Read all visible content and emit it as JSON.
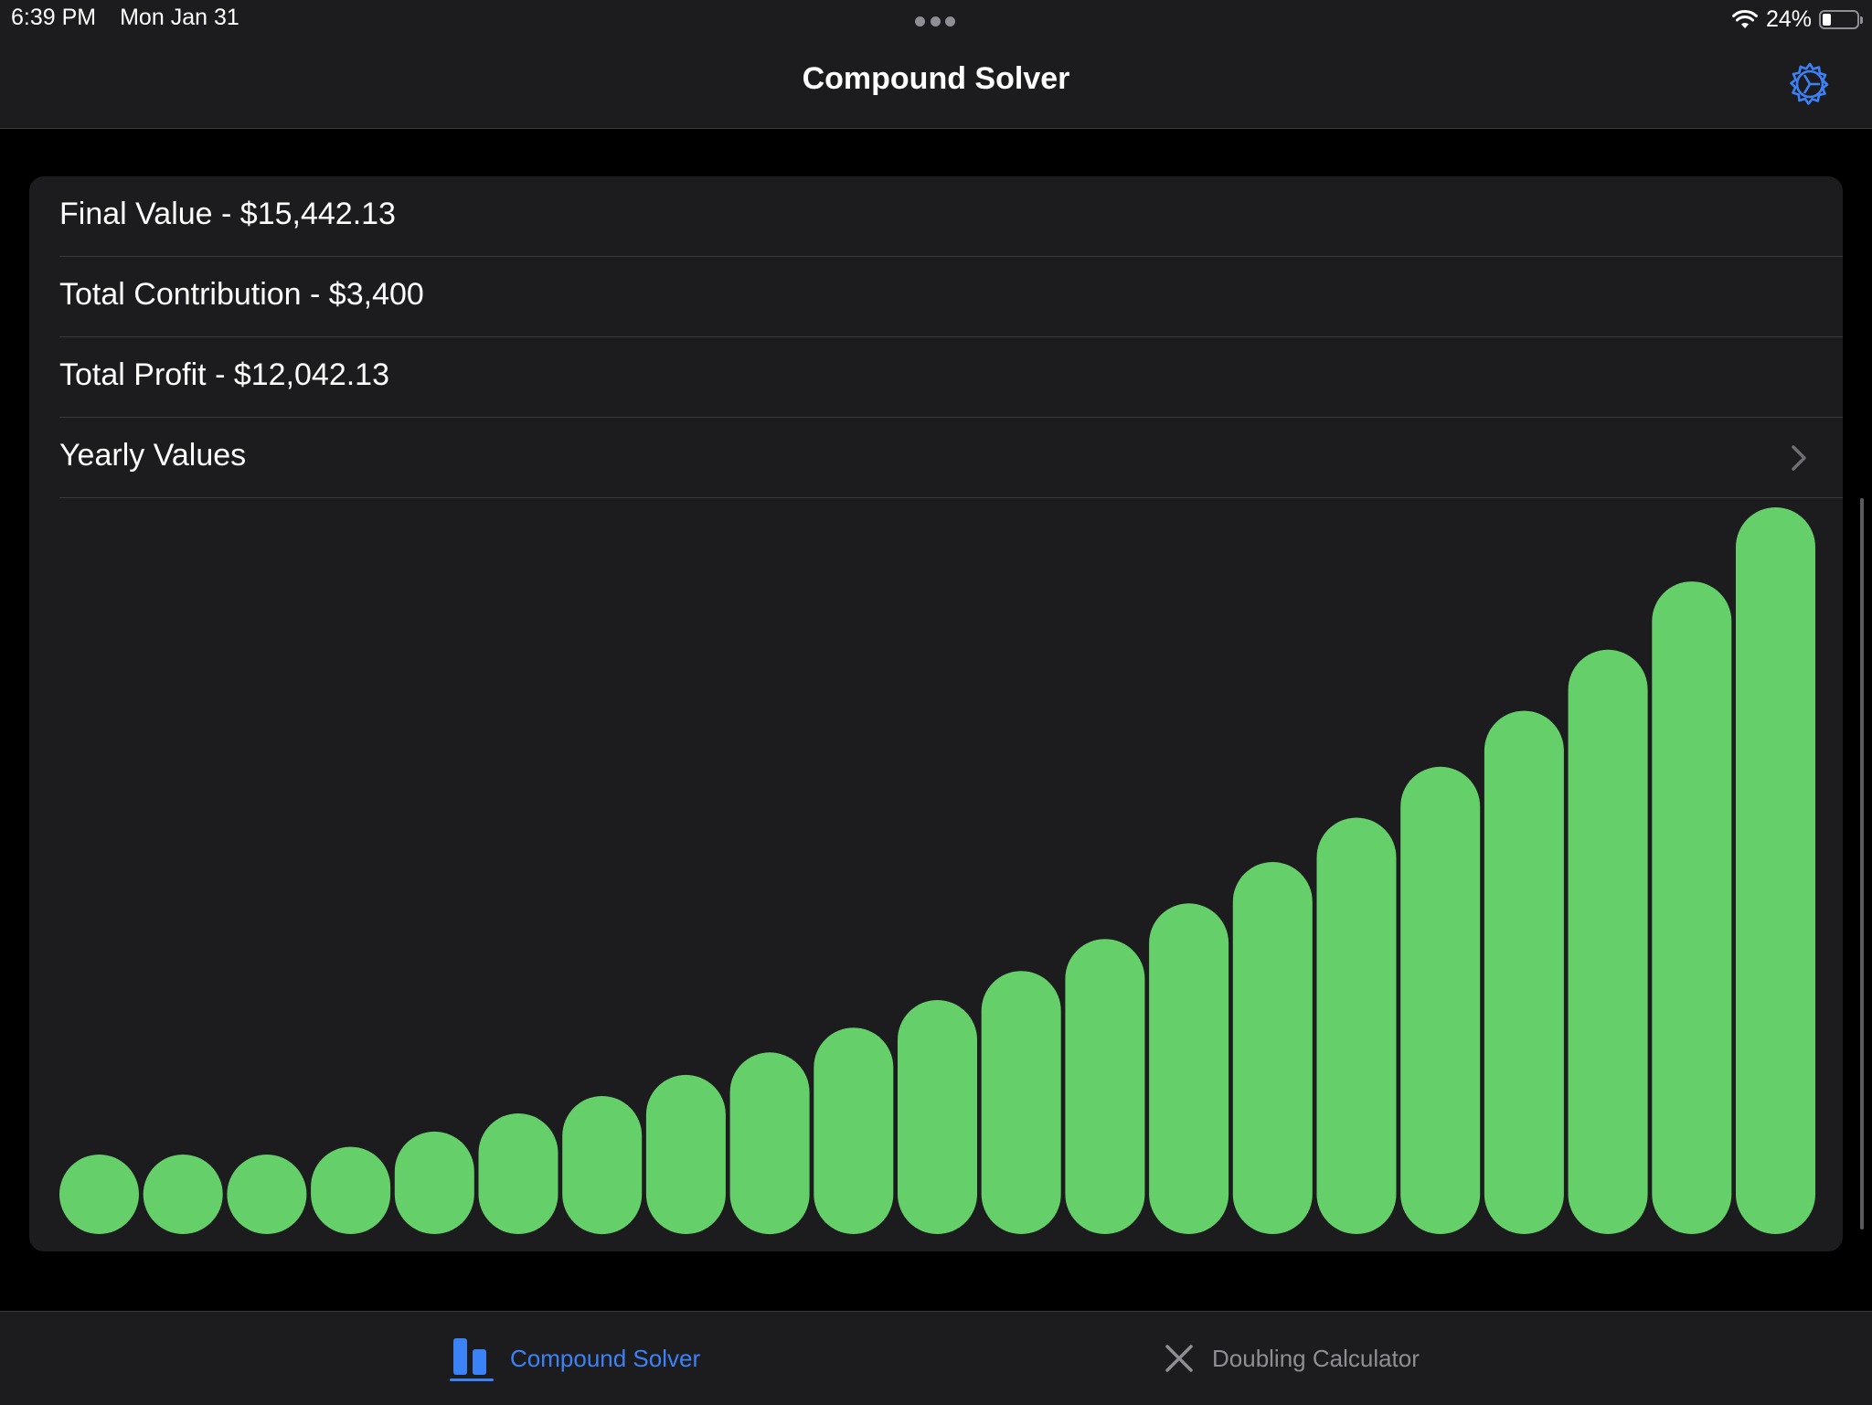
{
  "status_bar": {
    "time": "6:39 PM",
    "date": "Mon Jan 31",
    "battery": "24%",
    "battery_level": 0.24,
    "icons": [
      "multitasking-dots-icon",
      "wifi-icon",
      "battery-icon"
    ]
  },
  "nav": {
    "title": "Compound Solver",
    "settings_icon": "gear-icon"
  },
  "summary": {
    "final_value": "Final Value - $15,442.13",
    "total_contribution": "Total Contribution - $3,400",
    "total_profit": "Total Profit - $12,042.13",
    "yearly_values": "Yearly Values",
    "chevron_icon": "chevron-right-icon"
  },
  "chart_data": {
    "type": "bar",
    "color": "#65d06a",
    "values": [
      0.065,
      0.081,
      0.099,
      0.12,
      0.141,
      0.166,
      0.19,
      0.219,
      0.25,
      0.284,
      0.322,
      0.362,
      0.406,
      0.455,
      0.512,
      0.573,
      0.643,
      0.72,
      0.804,
      0.898,
      1.0
    ],
    "ylim": [
      0,
      1
    ],
    "grid": false,
    "legend": false
  },
  "tabs": [
    {
      "label": "Compound Solver",
      "icon": "bar-chart-icon",
      "selected": true
    },
    {
      "label": "Doubling Calculator",
      "icon": "close-x-icon",
      "selected": false
    }
  ],
  "colors": {
    "accent": "#3b82f6",
    "background": "#000000",
    "card": "#1c1c1e",
    "bar": "#65d06a",
    "inactive": "#8e8e93"
  }
}
